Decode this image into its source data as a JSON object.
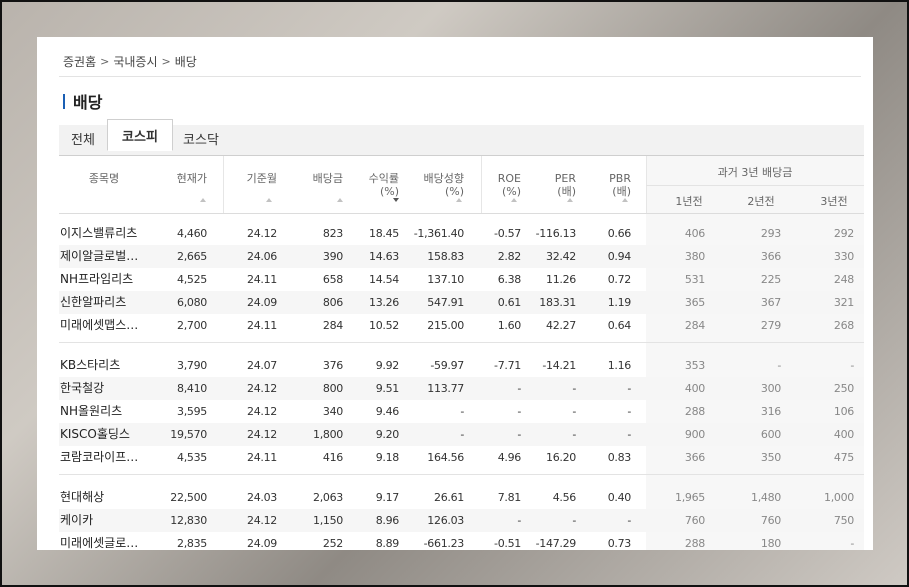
{
  "breadcrumb": [
    "증권홈",
    "국내증시",
    "배당"
  ],
  "page_title": "배당",
  "tabs": [
    {
      "label": "전체",
      "active": false
    },
    {
      "label": "코스피",
      "active": true
    },
    {
      "label": "코스닥",
      "active": false
    }
  ],
  "columns": {
    "name": "종목명",
    "price": "현재가",
    "base_month": "기준월",
    "dividend": "배당금",
    "yield": [
      "수익률",
      "(%)"
    ],
    "payout": [
      "배당성향",
      "(%)"
    ],
    "roe": [
      "ROE",
      "(%)"
    ],
    "per": [
      "PER",
      "(배)"
    ],
    "pbr": [
      "PBR",
      "(배)"
    ],
    "past_title": "과거 3년 배당금",
    "past_1": "1년전",
    "past_2": "2년전",
    "past_3": "3년전"
  },
  "rows": [
    [
      "이지스밸류리츠",
      "4,460",
      "24.12",
      "823",
      "18.45",
      "-1,361.40",
      "-0.57",
      "-116.13",
      "0.66",
      "406",
      "293",
      "292"
    ],
    [
      "제이알글로벌…",
      "2,665",
      "24.06",
      "390",
      "14.63",
      "158.83",
      "2.82",
      "32.42",
      "0.94",
      "380",
      "366",
      "330"
    ],
    [
      "NH프라임리츠",
      "4,525",
      "24.11",
      "658",
      "14.54",
      "137.10",
      "6.38",
      "11.26",
      "0.72",
      "531",
      "225",
      "248"
    ],
    [
      "신한알파리츠",
      "6,080",
      "24.09",
      "806",
      "13.26",
      "547.91",
      "0.61",
      "183.31",
      "1.19",
      "365",
      "367",
      "321"
    ],
    [
      "미래에셋맵스…",
      "2,700",
      "24.11",
      "284",
      "10.52",
      "215.00",
      "1.60",
      "42.27",
      "0.64",
      "284",
      "279",
      "268"
    ],
    [
      "KB스타리츠",
      "3,790",
      "24.07",
      "376",
      "9.92",
      "-59.97",
      "-7.71",
      "-14.21",
      "1.16",
      "353",
      "-",
      "-"
    ],
    [
      "한국철강",
      "8,410",
      "24.12",
      "800",
      "9.51",
      "113.77",
      "-",
      "-",
      "-",
      "400",
      "300",
      "250"
    ],
    [
      "NH올원리츠",
      "3,595",
      "24.12",
      "340",
      "9.46",
      "-",
      "-",
      "-",
      "-",
      "288",
      "316",
      "106"
    ],
    [
      "KISCO홀딩스",
      "19,570",
      "24.12",
      "1,800",
      "9.20",
      "-",
      "-",
      "-",
      "-",
      "900",
      "600",
      "400"
    ],
    [
      "코람코라이프…",
      "4,535",
      "24.11",
      "416",
      "9.18",
      "164.56",
      "4.96",
      "16.20",
      "0.83",
      "366",
      "350",
      "475"
    ],
    [
      "현대해상",
      "22,500",
      "24.03",
      "2,063",
      "9.17",
      "26.61",
      "7.81",
      "4.56",
      "0.40",
      "1,965",
      "1,480",
      "1,000"
    ],
    [
      "케이카",
      "12,830",
      "24.12",
      "1,150",
      "8.96",
      "126.03",
      "-",
      "-",
      "-",
      "760",
      "760",
      "750"
    ],
    [
      "미래에셋글로…",
      "2,835",
      "24.09",
      "252",
      "8.89",
      "-661.23",
      "-0.51",
      "-147.29",
      "0.73",
      "288",
      "180",
      "-"
    ]
  ]
}
